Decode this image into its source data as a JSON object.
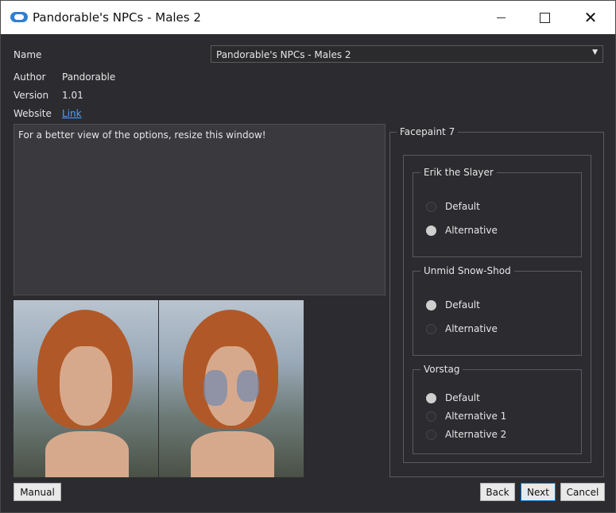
{
  "window": {
    "title": "Pandorable's NPCs - Males 2",
    "controls": {
      "minimize": "minimize",
      "maximize": "maximize",
      "close": "close"
    }
  },
  "info": {
    "name_label": "Name",
    "name_value": "Pandorable's NPCs - Males 2",
    "author_label": "Author",
    "author_value": "Pandorable",
    "version_label": "Version",
    "version_value": "1.01",
    "website_label": "Website",
    "website_link": "Link"
  },
  "description": "For a better view of the options, resize this window!",
  "options_panel": {
    "title": "Facepaint 7",
    "groups": [
      {
        "title": "Erik the Slayer",
        "options": [
          {
            "label": "Default",
            "selected": false
          },
          {
            "label": "Alternative",
            "selected": true
          }
        ]
      },
      {
        "title": "Unmid Snow-Shod",
        "options": [
          {
            "label": "Default",
            "selected": true
          },
          {
            "label": "Alternative",
            "selected": false
          }
        ]
      },
      {
        "title": "Vorstag",
        "options": [
          {
            "label": "Default",
            "selected": true
          },
          {
            "label": "Alternative 1",
            "selected": false
          },
          {
            "label": "Alternative 2",
            "selected": false
          }
        ]
      }
    ]
  },
  "buttons": {
    "manual": "Manual",
    "back": "Back",
    "next": "Next",
    "cancel": "Cancel"
  },
  "icons": {
    "app": "mo2-app-icon",
    "dropdown": "chevron-down-icon"
  }
}
